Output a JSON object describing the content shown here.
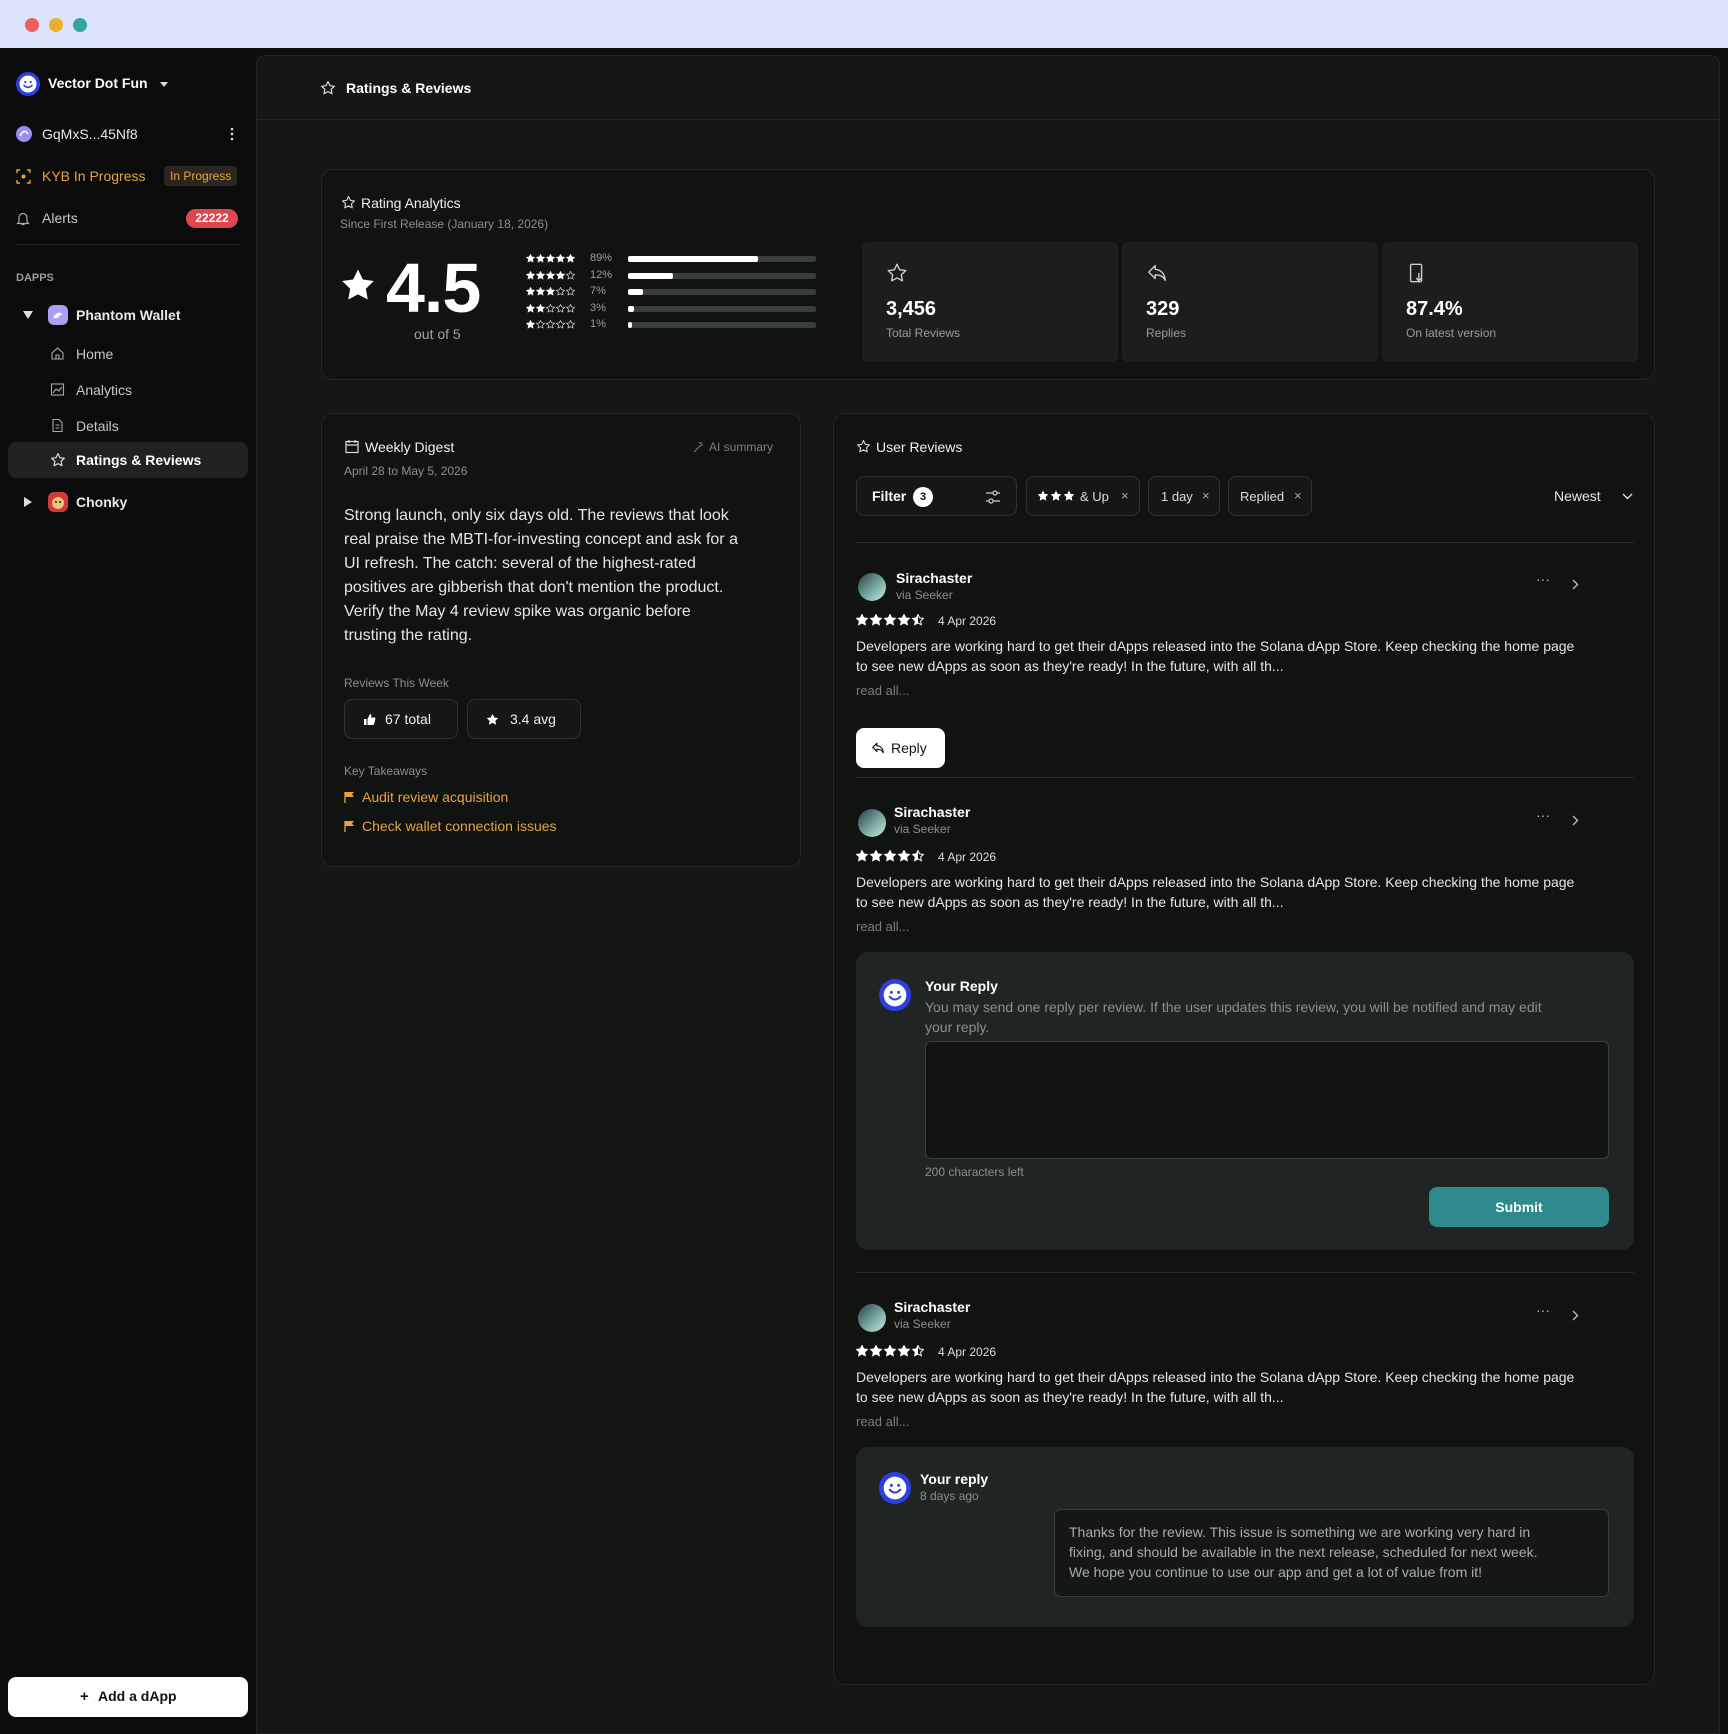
{
  "window": {
    "traffic_colors": [
      "#ec5f5e",
      "#e9b12e",
      "#34a59e"
    ]
  },
  "sidebar": {
    "org_name": "Vector Dot Fun",
    "wallet": "GqMxS...45Nf8",
    "kyb_label": "KYB In Progress",
    "kyb_badge": "In Progress",
    "alerts_label": "Alerts",
    "alerts_count": "22222",
    "section_label": "DAPPS",
    "dapps": [
      {
        "name": "Phantom Wallet",
        "items": [
          "Home",
          "Analytics",
          "Details",
          "Ratings & Reviews"
        ]
      },
      {
        "name": "Chonky"
      }
    ],
    "add_button": "Add a dApp"
  },
  "header": {
    "title": "Ratings & Reviews"
  },
  "analytics": {
    "title": "Rating Analytics",
    "subtitle": "Since First Release (January 18, 2026)",
    "rating": "4.5",
    "out_of": "out of 5",
    "distribution": [
      {
        "stars": 5,
        "label": "89%",
        "fraction": 0.69
      },
      {
        "stars": 4,
        "label": "12%",
        "fraction": 0.24
      },
      {
        "stars": 3,
        "label": "7%",
        "fraction": 0.08
      },
      {
        "stars": 2,
        "label": "3%",
        "fraction": 0.03
      },
      {
        "stars": 1,
        "label": "1%",
        "fraction": 0.02
      }
    ],
    "stats": [
      {
        "value": "3,456",
        "label": "Total Reviews",
        "icon": "star-icon"
      },
      {
        "value": "329",
        "label": "Replies",
        "icon": "reply-icon"
      },
      {
        "value": "87.4%",
        "label": "On latest version",
        "icon": "device-download-icon"
      }
    ]
  },
  "digest": {
    "title": "Weekly Digest",
    "ai_label": "AI summary",
    "date_range": "April 28 to May 5, 2026",
    "summary_lines": [
      "Strong launch, only six days old. The reviews that look",
      "real praise the MBTI-for-investing concept and ask for a",
      "UI refresh. The catch: several of the highest-rated",
      "positives are gibberish that don't mention the product.",
      "Verify the May 4 review spike was organic before",
      "trusting the rating."
    ],
    "reviews_week_label": "Reviews This Week",
    "total_chip": "67 total",
    "avg_chip": "3.4 avg",
    "takeaways_label": "Key Takeaways",
    "takeaways": [
      "Audit review acquisition",
      "Check wallet connection issues"
    ]
  },
  "reviews": {
    "title": "User Reviews",
    "filter_label": "Filter",
    "filter_count": "3",
    "chips": [
      "& Up",
      "1 day",
      "Replied"
    ],
    "sort": "Newest",
    "items": [
      {
        "author": "Sirachaster",
        "source": "via Seeker",
        "date": "4 Apr 2026",
        "rating": 4.5,
        "lines": [
          "Developers are working hard to get their dApps released into the Solana dApp Store. Keep checking the home page",
          "to see new dApps as soon as they're ready! In the future, with all th..."
        ],
        "read_all": "read all...",
        "reply_button": "Reply"
      },
      {
        "author": "Sirachaster",
        "source": "via Seeker",
        "date": "4 Apr 2026",
        "rating": 4.5,
        "lines": [
          "Developers are working hard to get their dApps released into the Solana dApp Store. Keep checking the home page",
          "to see new dApps as soon as they're ready! In the future, with all th..."
        ],
        "read_all": "read all...",
        "reply_form": {
          "title": "Your Reply",
          "hint_lines": [
            "You may send one reply per review. If the user updates this review, you will be notified and may edit",
            "your reply."
          ],
          "value": "",
          "chars_left": "200 characters left",
          "submit": "Submit"
        }
      },
      {
        "author": "Sirachaster",
        "source": "via Seeker",
        "date": "4 Apr 2026",
        "rating": 4.5,
        "lines": [
          "Developers are working hard to get their dApps released into the Solana dApp Store. Keep checking the home page",
          "to see new dApps as soon as they're ready! In the future, with all th..."
        ],
        "read_all": "read all...",
        "existing_reply": {
          "title": "Your reply",
          "time": "8 days ago",
          "lines": [
            "Thanks for the review. This issue is something we are working very hard in",
            "fixing, and should be available in the next release, scheduled for next week.",
            "We hope you continue to use our app and get a lot of value from it!"
          ]
        }
      }
    ]
  },
  "colors": {
    "accent_orange": "#e8a43a",
    "alert_red": "#e0464f",
    "submit_teal": "#2e8a8c",
    "brand_blue": "#2c3fe0"
  }
}
